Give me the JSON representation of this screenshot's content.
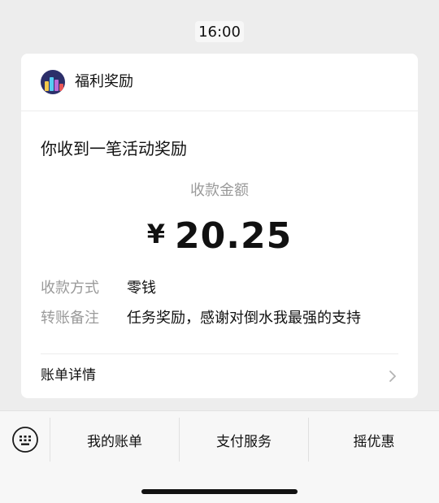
{
  "chat": {
    "timestamp": "16:00"
  },
  "card": {
    "app_name": "福利奖励",
    "headline": "你收到一笔活动奖励",
    "amount_label": "收款金额",
    "currency_symbol": "¥",
    "amount": "20.25",
    "details": [
      {
        "label": "收款方式",
        "value": "零钱"
      },
      {
        "label": "转账备注",
        "value": "任务奖励，感谢对倒水我最强的支持"
      }
    ],
    "bill_details_label": "账单详情"
  },
  "bottom_menu": {
    "items": [
      {
        "label": "我的账单"
      },
      {
        "label": "支付服务"
      },
      {
        "label": "摇优惠"
      }
    ]
  },
  "icons": {
    "avatar": "app-logo-icon",
    "chevron": "chevron-right-icon",
    "keyboard": "keyboard-icon"
  }
}
